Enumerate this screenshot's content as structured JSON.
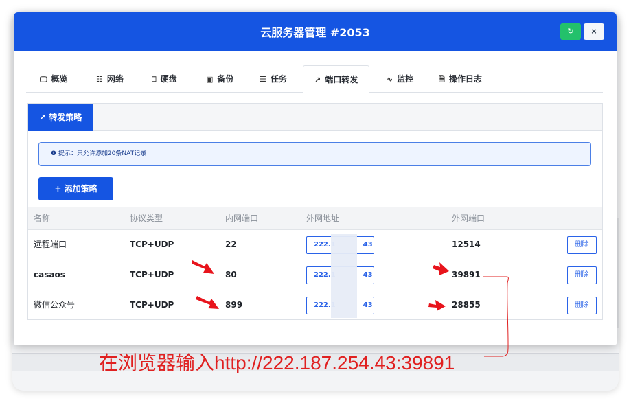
{
  "window": {
    "title": "云服务器管理 #2053",
    "refresh_icon": "refresh-icon",
    "close_label": "×"
  },
  "tabs": [
    {
      "label": "概览",
      "icon": "monitor-icon"
    },
    {
      "label": "网络",
      "icon": "network-icon"
    },
    {
      "label": "硬盘",
      "icon": "disk-icon"
    },
    {
      "label": "备份",
      "icon": "save-icon"
    },
    {
      "label": "任务",
      "icon": "list-icon"
    },
    {
      "label": "端口转发",
      "icon": "external-link-icon",
      "active": true
    },
    {
      "label": "监控",
      "icon": "pulse-icon"
    },
    {
      "label": "操作日志",
      "icon": "file-icon"
    }
  ],
  "panel": {
    "subtab_label": "转发策略",
    "notice": "提示：只允许添加20条NAT记录",
    "add_button": "添加策略"
  },
  "table": {
    "headers": [
      "名称",
      "协议类型",
      "内网端口",
      "外网地址",
      "外网端口"
    ],
    "rows": [
      {
        "name": "远程端口",
        "protocol": "TCP+UDP",
        "internal_port": "22",
        "ext_addr_start": "222.1",
        "ext_addr_end": "43",
        "ext_port": "12514",
        "action": "删除"
      },
      {
        "name": "casaos",
        "protocol": "TCP+UDP",
        "internal_port": "80",
        "ext_addr_start": "222.1",
        "ext_addr_end": "43",
        "ext_port": "39891",
        "action": "删除"
      },
      {
        "name": "微信公众号",
        "protocol": "TCP+UDP",
        "internal_port": "899",
        "ext_addr_start": "222.1",
        "ext_addr_end": "43",
        "ext_port": "28855",
        "action": "删除"
      }
    ]
  },
  "annotation": {
    "caption": "在浏览器输入http://222.187.254.43:39891",
    "color": "#e02020"
  },
  "colors": {
    "primary": "#1555e2",
    "success": "#23c16b"
  }
}
